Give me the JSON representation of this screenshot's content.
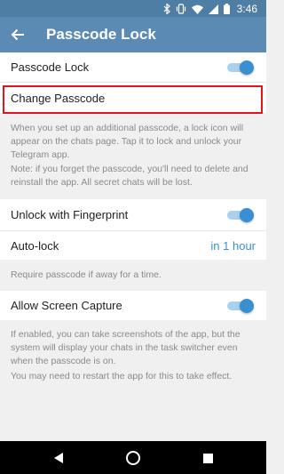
{
  "status_bar": {
    "time": "3:46"
  },
  "header": {
    "title": "Passcode Lock"
  },
  "rows": {
    "passcode_lock": {
      "label": "Passcode Lock",
      "enabled": true
    },
    "change_passcode": {
      "label": "Change Passcode"
    },
    "fingerprint": {
      "label": "Unlock with Fingerprint",
      "enabled": true
    },
    "auto_lock": {
      "label": "Auto-lock",
      "value": "in 1 hour"
    },
    "screen_capture": {
      "label": "Allow Screen Capture",
      "enabled": true
    }
  },
  "notes": {
    "passcode_info": "When you set up an additional passcode, a lock icon will appear on the chats page. Tap it to lock and unlock your Telegram app.",
    "passcode_warning": "Note: if you forget the passcode, you'll need to delete and reinstall the app. All secret chats will be lost.",
    "autolock_info": "Require passcode if away for a time.",
    "capture_info": "If enabled, you can take screenshots of the app, but the system will display your chats in the task switcher even when the passcode is on.",
    "capture_restart": "You may need to restart the app for this to take effect."
  },
  "colors": {
    "accent": "#3a8fd1",
    "app_bar": "#5b8ab5",
    "status_bar": "#4f7ea5",
    "highlight": "#e3141d"
  },
  "icons": [
    "bluetooth-icon",
    "vibrate-icon",
    "wifi-icon",
    "signal-icon",
    "battery-icon",
    "back-arrow-icon",
    "nav-back-icon",
    "nav-home-icon",
    "nav-recents-icon"
  ]
}
